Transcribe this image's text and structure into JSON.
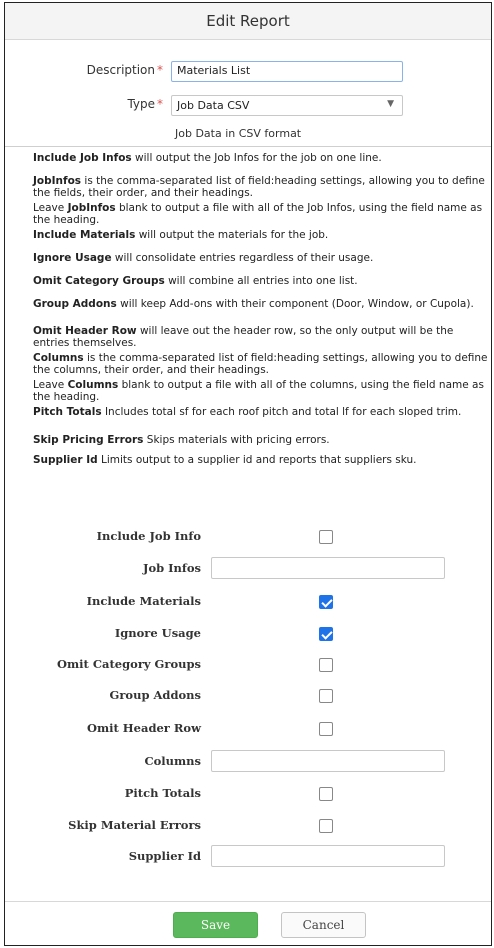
{
  "dialog": {
    "title": "Edit Report"
  },
  "description": {
    "label": "Description",
    "value": "Materials List"
  },
  "type": {
    "label": "Type",
    "selected": "Job Data CSV",
    "description": "Job Data in CSV format"
  },
  "help": [
    {
      "bold": "Include Job Infos",
      "text": " will output the Job Infos for the job on one line."
    },
    {
      "bold": "JobInfos",
      "text": " is the comma-separated list of field:heading settings, allowing you to define the fields, their order, and their headings."
    },
    {
      "pre": "Leave ",
      "bold": "JobInfos",
      "text": " blank to output a file with all of the Job Infos, using the field name as the heading."
    },
    {
      "bold": "Include Materials",
      "text": " will output the materials for the job."
    },
    {
      "bold": "Ignore Usage",
      "text": " will consolidate entries regardless of their usage."
    },
    {
      "bold": "Omit Category Groups",
      "text": " will combine all entries into one list."
    },
    {
      "bold": "Group Addons",
      "text": " will keep Add-ons with their component (Door, Window, or Cupola)."
    },
    {
      "bold": "Omit Header Row",
      "text": " will leave out the header row, so the only output will be the entries themselves."
    },
    {
      "bold": "Columns",
      "text": " is the comma-separated list of field:heading settings, allowing you to define the columns, their order, and their headings."
    },
    {
      "pre": "Leave ",
      "bold": "Columns",
      "text": " blank to output a file with all of the columns, using the field name as the heading."
    },
    {
      "bold": "Pitch Totals",
      "text": " Includes total sf for each roof pitch and total lf for each sloped trim."
    },
    {
      "bold": "Skip Pricing Errors",
      "text": " Skips materials with pricing errors."
    },
    {
      "bold": "Supplier Id",
      "text": " Limits output to a supplier id and reports that suppliers sku."
    }
  ],
  "fields": [
    {
      "label": "Include Job Info",
      "kind": "checkbox",
      "checked": false
    },
    {
      "label": "Job Infos",
      "kind": "text",
      "value": ""
    },
    {
      "label": "Include Materials",
      "kind": "checkbox",
      "checked": true
    },
    {
      "label": "Ignore Usage",
      "kind": "checkbox",
      "checked": true
    },
    {
      "label": "Omit Category Groups",
      "kind": "checkbox",
      "checked": false
    },
    {
      "label": "Group Addons",
      "kind": "checkbox",
      "checked": false
    },
    {
      "label": "Omit Header Row",
      "kind": "checkbox",
      "checked": false
    },
    {
      "label": "Columns",
      "kind": "text",
      "value": ""
    },
    {
      "label": "Pitch Totals",
      "kind": "checkbox",
      "checked": false
    },
    {
      "label": "Skip Material Errors",
      "kind": "checkbox",
      "checked": false
    },
    {
      "label": "Supplier Id",
      "kind": "text",
      "value": ""
    }
  ],
  "buttons": {
    "save": "Save",
    "cancel": "Cancel"
  },
  "colors": {
    "accent": "#1e73e8",
    "save": "#5cb85c",
    "required": "#d9534f"
  }
}
